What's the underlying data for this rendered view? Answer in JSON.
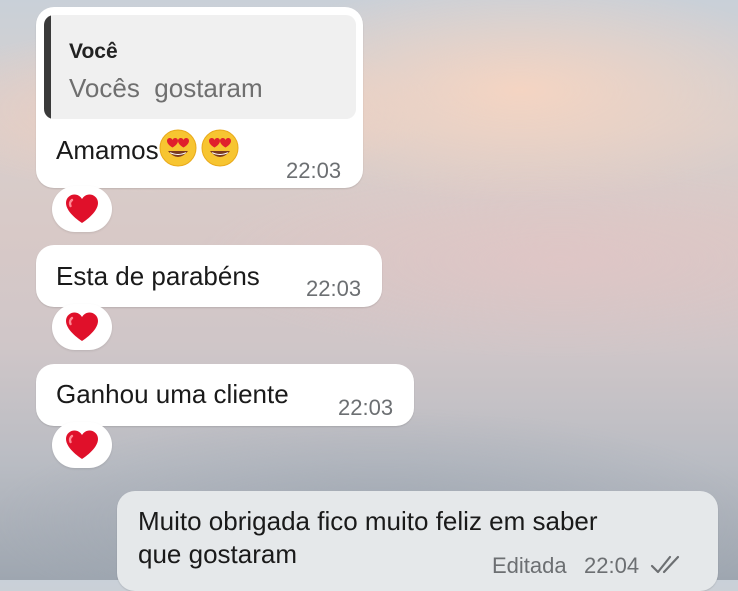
{
  "chat": {
    "messages": [
      {
        "quote": {
          "author": "Você",
          "text": "Vocês  gostaram"
        },
        "text": "Amamos",
        "emojis": [
          "heart-eyes-icon",
          "heart-eyes-icon"
        ],
        "time": "22:03",
        "reaction": "❤️"
      },
      {
        "text": "Esta de parabéns",
        "time": "22:03",
        "reaction": "❤️"
      },
      {
        "text": "Ganhou uma cliente",
        "time": "22:03",
        "reaction": "❤️"
      },
      {
        "text_line1": "Muito obrigada fico muito feliz em saber",
        "text_line2": "que gostaram",
        "edited_label": "Editada",
        "time": "22:04",
        "status": "double-check-icon"
      }
    ]
  },
  "colors": {
    "incoming_bubble": "#ffffff",
    "outgoing_bubble": "#e5e8ea",
    "time_text": "#6c6f72",
    "quote_bar": "#3a3a3a",
    "reaction_heart": "#e0102a"
  }
}
